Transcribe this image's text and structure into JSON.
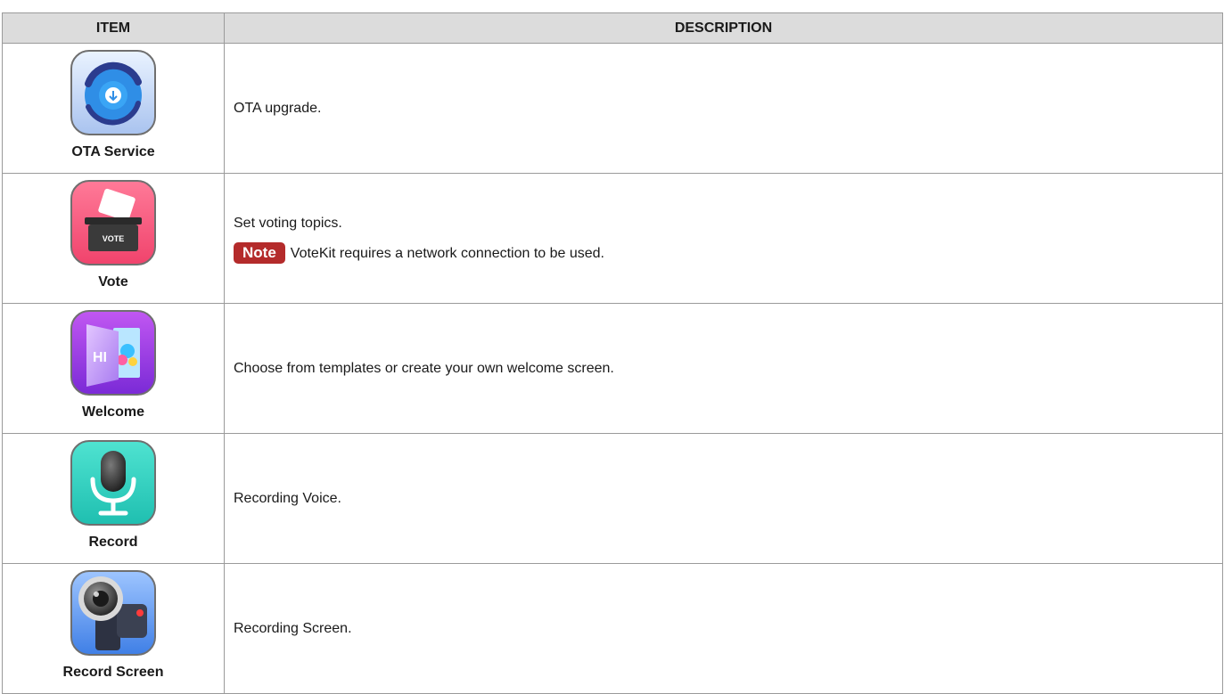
{
  "table": {
    "headers": {
      "item": "ITEM",
      "description": "DESCRIPTION"
    },
    "rows": [
      {
        "name": "OTA Service",
        "icon": "ota-service-icon",
        "description": "OTA upgrade."
      },
      {
        "name": "Vote",
        "icon": "vote-icon",
        "icon_text": "VOTE",
        "description": "Set voting topics.",
        "note_label": "Note",
        "note_text": "VoteKit requires a network connection to be used."
      },
      {
        "name": "Welcome",
        "icon": "welcome-icon",
        "icon_text": "HI",
        "description": "Choose from templates or create your own welcome screen."
      },
      {
        "name": "Record",
        "icon": "microphone-icon",
        "description": "Recording Voice."
      },
      {
        "name": "Record Screen",
        "icon": "video-camera-icon",
        "description": "Recording Screen."
      }
    ]
  },
  "colors": {
    "header_bg": "#dcdcdc",
    "note_badge": "#b42b2b",
    "border": "#9a9a9a"
  }
}
